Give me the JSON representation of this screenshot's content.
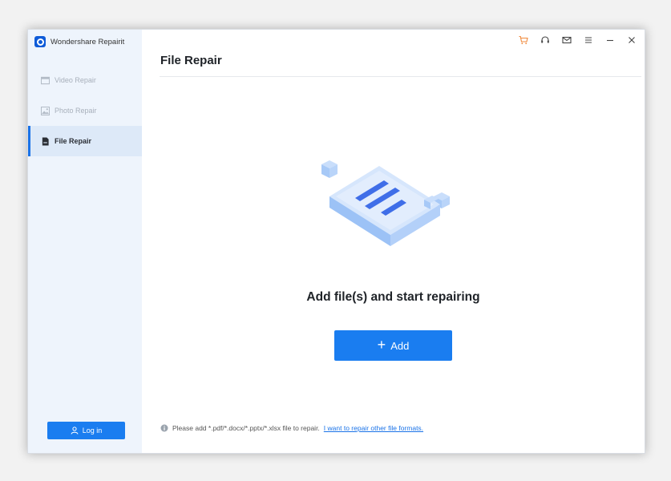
{
  "app": {
    "name": "Wondershare Repairit"
  },
  "sidebar": {
    "items": [
      {
        "label": "Video Repair",
        "icon": "video-icon",
        "active": false
      },
      {
        "label": "Photo Repair",
        "icon": "photo-icon",
        "active": false
      },
      {
        "label": "File Repair",
        "icon": "file-icon",
        "active": true
      }
    ],
    "login_label": "Log in"
  },
  "toolbar": {
    "icons": [
      "cart-icon",
      "headset-icon",
      "mail-icon",
      "menu-icon",
      "minimize-icon",
      "close-icon"
    ],
    "cart_color": "#f08a3c"
  },
  "main": {
    "title": "File Repair",
    "prompt": "Add file(s) and start repairing",
    "add_label": "Add",
    "footer_text": "Please add *.pdf/*.docx/*.pptx/*.xlsx file to repair.",
    "footer_link": "I want to repair other file formats."
  },
  "colors": {
    "accent": "#1a7df0",
    "sidebar_bg": "#eef4fc",
    "active_bg": "#dde9f8"
  }
}
